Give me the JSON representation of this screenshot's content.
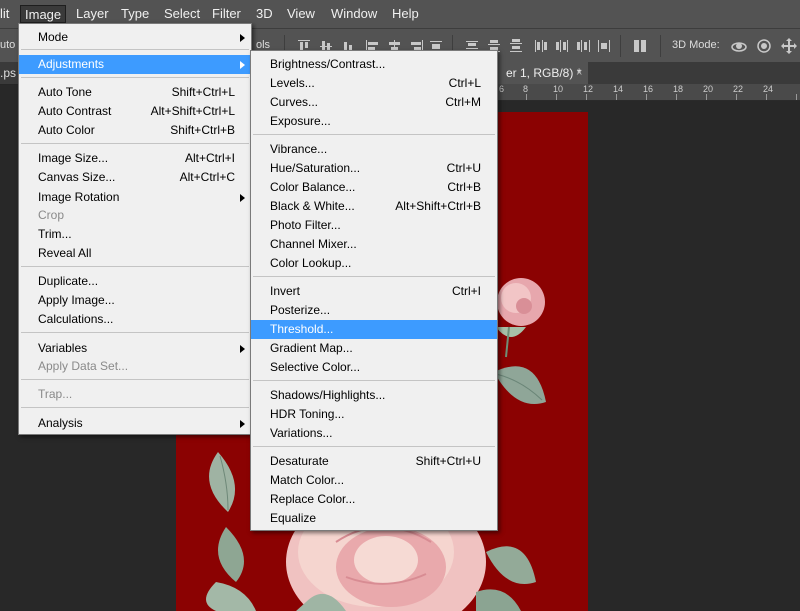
{
  "menubar": {
    "items": [
      "lit",
      "Image",
      "Layer",
      "Type",
      "Select",
      "Filter",
      "3D",
      "View",
      "Window",
      "Help"
    ]
  },
  "options": {
    "auto_label": "uto",
    "controls_label": "ols",
    "mode_3d_label": "3D Mode:"
  },
  "tabs": {
    "left_partial": ".ps",
    "doc_label": "er 1, RGB/8) *",
    "close": "×"
  },
  "ruler": {
    "labels": [
      "6",
      "8",
      "10",
      "12",
      "14",
      "16",
      "18",
      "20",
      "22",
      "24"
    ]
  },
  "image_menu": {
    "items": [
      {
        "label": "Mode",
        "shortcut": "",
        "submenu": true
      },
      {
        "label": "Adjustments",
        "shortcut": "",
        "submenu": true,
        "highlighted": true
      },
      {
        "label": "Auto Tone",
        "shortcut": "Shift+Ctrl+L"
      },
      {
        "label": "Auto Contrast",
        "shortcut": "Alt+Shift+Ctrl+L"
      },
      {
        "label": "Auto Color",
        "shortcut": "Shift+Ctrl+B"
      },
      {
        "label": "Image Size...",
        "shortcut": "Alt+Ctrl+I"
      },
      {
        "label": "Canvas Size...",
        "shortcut": "Alt+Ctrl+C"
      },
      {
        "label": "Image Rotation",
        "shortcut": "",
        "submenu": true
      },
      {
        "label": "Crop",
        "shortcut": "",
        "disabled": true
      },
      {
        "label": "Trim...",
        "shortcut": ""
      },
      {
        "label": "Reveal All",
        "shortcut": ""
      },
      {
        "label": "Duplicate...",
        "shortcut": ""
      },
      {
        "label": "Apply Image...",
        "shortcut": ""
      },
      {
        "label": "Calculations...",
        "shortcut": ""
      },
      {
        "label": "Variables",
        "shortcut": "",
        "submenu": true
      },
      {
        "label": "Apply Data Set...",
        "shortcut": "",
        "disabled": true
      },
      {
        "label": "Trap...",
        "shortcut": "",
        "disabled": true
      },
      {
        "label": "Analysis",
        "shortcut": "",
        "submenu": true
      }
    ]
  },
  "adjustments_menu": {
    "items": [
      {
        "label": "Brightness/Contrast...",
        "shortcut": ""
      },
      {
        "label": "Levels...",
        "shortcut": "Ctrl+L"
      },
      {
        "label": "Curves...",
        "shortcut": "Ctrl+M"
      },
      {
        "label": "Exposure...",
        "shortcut": ""
      },
      {
        "label": "Vibrance...",
        "shortcut": ""
      },
      {
        "label": "Hue/Saturation...",
        "shortcut": "Ctrl+U"
      },
      {
        "label": "Color Balance...",
        "shortcut": "Ctrl+B"
      },
      {
        "label": "Black & White...",
        "shortcut": "Alt+Shift+Ctrl+B"
      },
      {
        "label": "Photo Filter...",
        "shortcut": ""
      },
      {
        "label": "Channel Mixer...",
        "shortcut": ""
      },
      {
        "label": "Color Lookup...",
        "shortcut": ""
      },
      {
        "label": "Invert",
        "shortcut": "Ctrl+I"
      },
      {
        "label": "Posterize...",
        "shortcut": ""
      },
      {
        "label": "Threshold...",
        "shortcut": "",
        "highlighted": true
      },
      {
        "label": "Gradient Map...",
        "shortcut": ""
      },
      {
        "label": "Selective Color...",
        "shortcut": ""
      },
      {
        "label": "Shadows/Highlights...",
        "shortcut": ""
      },
      {
        "label": "HDR Toning...",
        "shortcut": ""
      },
      {
        "label": "Variations...",
        "shortcut": ""
      },
      {
        "label": "Desaturate",
        "shortcut": "Shift+Ctrl+U"
      },
      {
        "label": "Match Color...",
        "shortcut": ""
      },
      {
        "label": "Replace Color...",
        "shortcut": ""
      },
      {
        "label": "Equalize",
        "shortcut": ""
      }
    ]
  },
  "colors": {
    "canvas_bg": "#8b0202",
    "highlight": "#3d9bff",
    "menu_bg": "#f0f0f0",
    "chrome": "#535353"
  }
}
